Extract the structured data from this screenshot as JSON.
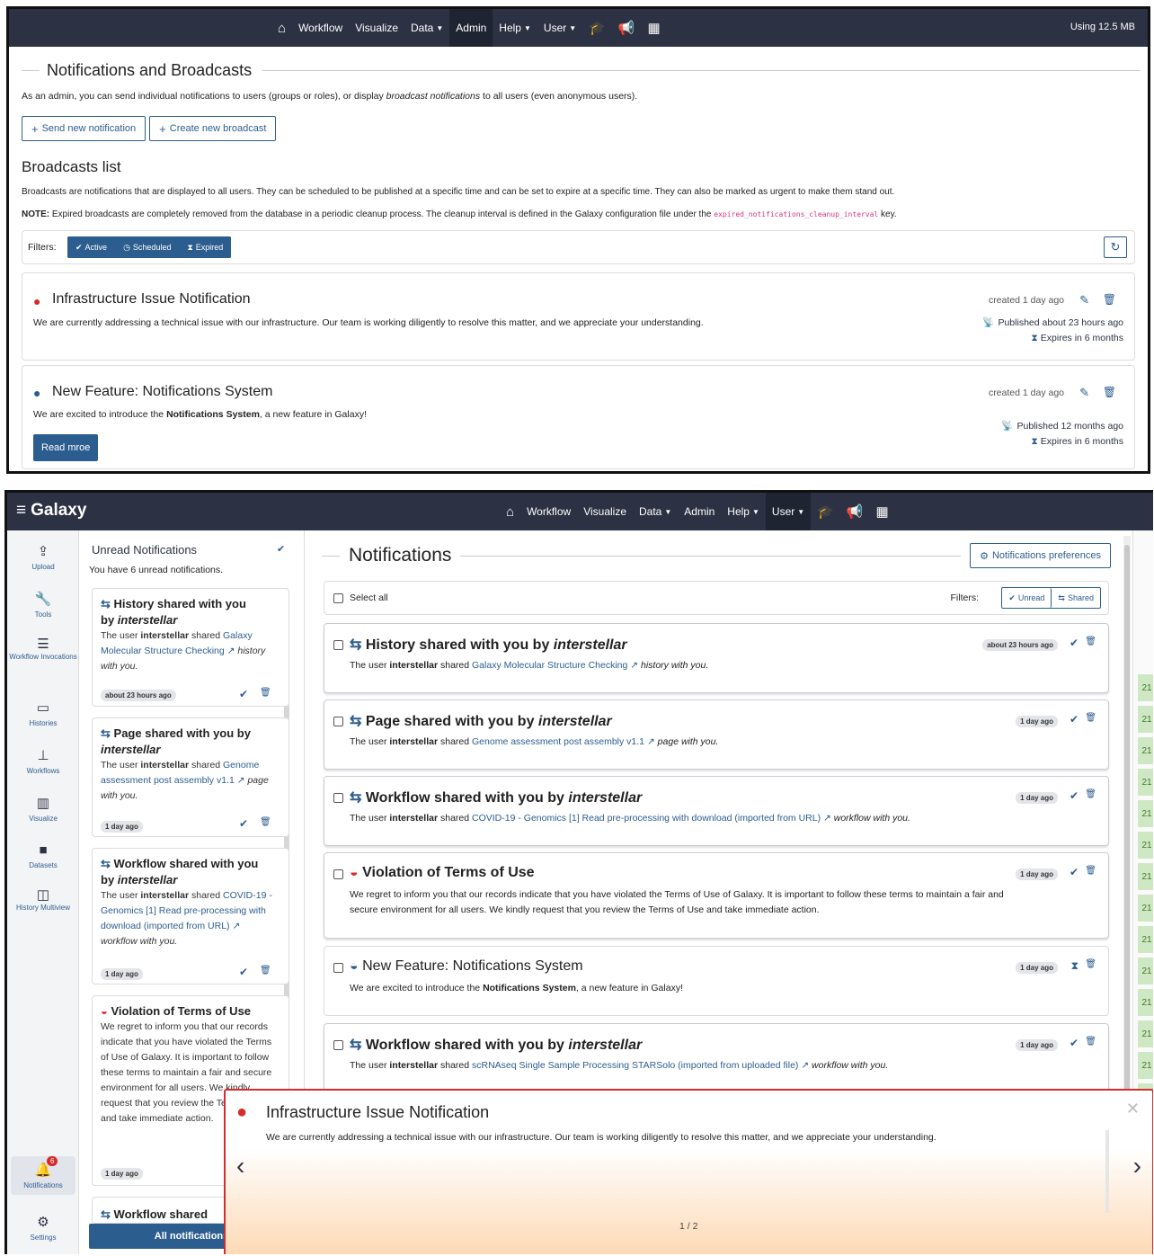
{
  "top": {
    "nav": {
      "items": [
        "Workflow",
        "Visualize",
        "Data",
        "Admin",
        "Help",
        "User"
      ],
      "memory": "Using 12.5 MB"
    },
    "title": "Notifications and Broadcasts",
    "intro_a": "As an admin, you can send individual notifications to users (groups or roles), or display ",
    "intro_em": "broadcast notifications",
    "intro_b": " to all users (even anonymous users).",
    "btn_send": "Send new notification",
    "btn_broadcast": "Create new broadcast",
    "list_title": "Broadcasts list",
    "list_desc": "Broadcasts are notifications that are displayed to all users. They can be scheduled to be published at a specific time and can be set to expire at a specific time. They can also be marked as urgent to make them stand out.",
    "note_label": "NOTE:",
    "note_text": " Expired broadcasts are completely removed from the database in a periodic cleanup process. The cleanup interval is defined in the Galaxy configuration file under the ",
    "note_code": "expired_notifications_cleanup_interval",
    "note_end": " key.",
    "filters_label": "Filters:",
    "filters": [
      "Active",
      "Scheduled",
      "Expired"
    ],
    "broadcasts": [
      {
        "title": "Infrastructure Issue Notification",
        "body": "We are currently addressing a technical issue with our infrastructure. Our team is working diligently to resolve this matter, and we appreciate your understanding.",
        "created": "created 1 day ago",
        "published": "Published about 23 hours ago",
        "expires": "Expires in 6 months"
      },
      {
        "title": "New Feature: Notifications System",
        "body_a": "We are excited to introduce the ",
        "body_b": "Notifications System",
        "body_c": ", a new feature in Galaxy!",
        "created": "created 1 day ago",
        "published": "Published 12 months ago",
        "expires": "Expires in 6 months",
        "read_more": "Read mroe"
      }
    ]
  },
  "bottom": {
    "brand": "Galaxy",
    "nav": {
      "items": [
        "Workflow",
        "Visualize",
        "Data",
        "Admin",
        "Help",
        "User"
      ],
      "notif_count": "6"
    },
    "sidebar": [
      "Upload",
      "Tools",
      "Workflow Invocations",
      "Histories",
      "Workflows",
      "Visualize",
      "Datasets",
      "History Multiview"
    ],
    "sidebar_bottom": [
      "Notifications",
      "Settings"
    ],
    "unread": {
      "title": "Unread Notifications",
      "subtitle": "You have 6 unread notifications.",
      "all_btn": "All notifications",
      "items": [
        {
          "t1": "History shared with you",
          "t2": "by ",
          "who": "interstellar",
          "body_a": "The user ",
          "user": "interstellar",
          "body_b": " shared ",
          "link": "Galaxy Molecular Structure Checking",
          "body_c": " history with you.",
          "time": "about 23 hours ago"
        },
        {
          "t1": "Page shared with you by",
          "who": "interstellar",
          "body_a": "The user ",
          "user": "interstellar",
          "body_b": " shared ",
          "link": "Genome assessment post assembly v1.1",
          "body_c": " page with you.",
          "time": "1 day ago"
        },
        {
          "t1": "Workflow shared with you",
          "t2": "by ",
          "who": "interstellar",
          "body_a": "The user ",
          "user": "interstellar",
          "body_b": " shared ",
          "link": "COVID-19 - Genomics [1] Read pre-processing with download (imported from URL)",
          "body_c": " workflow with you.",
          "time": "1 day ago"
        },
        {
          "t1": "Violation of Terms of Use",
          "body": "We regret to inform you that our records indicate that you have violated the Terms of Use of Galaxy. It is important to follow these terms to maintain a fair and secure environment for all users. We kindly request that you review the Terms of Use and take immediate action.",
          "time": "1 day ago"
        },
        {
          "t1": "Workflow shared"
        }
      ]
    },
    "main": {
      "title": "Notifications",
      "prefs": "Notifications preferences",
      "select_all": "Select all",
      "filters_label": "Filters:",
      "filters": [
        "Unread",
        "Shared"
      ],
      "items": [
        {
          "pre": "History shared with you by ",
          "who": "interstellar",
          "body_a": "The user ",
          "user": "interstellar",
          "body_b": " shared ",
          "link": "Galaxy Molecular Structure Checking",
          "body_c": " history with you.",
          "time": "about 23 hours ago"
        },
        {
          "pre": "Page shared with you by ",
          "who": "interstellar",
          "body_a": "The user ",
          "user": "interstellar",
          "body_b": " shared ",
          "link": "Genome assessment post assembly v1.1",
          "body_c": " page with you.",
          "time": "1 day ago"
        },
        {
          "pre": "Workflow shared with you by ",
          "who": "interstellar",
          "body_a": "The user ",
          "user": "interstellar",
          "body_b": " shared ",
          "link": "COVID-19 - Genomics [1] Read pre-processing with download (imported from URL)",
          "body_c": " workflow with you.",
          "time": "1 day ago"
        },
        {
          "pre": "Violation of Terms of Use",
          "line1": "We regret to inform you that our records indicate that you have violated the Terms of Use of Galaxy. It is important to follow these terms to maintain a fair and",
          "line2": "secure environment for all users. We kindly request that you review the Terms of Use and take immediate action.",
          "time": "1 day ago"
        },
        {
          "pre": "New Feature: Notifications System",
          "body_a": "We are excited to introduce the ",
          "body_b": "Notifications System",
          "body_c": ", a new feature in Galaxy!",
          "time": "1 day ago"
        },
        {
          "pre": "Workflow shared with you by ",
          "who": "interstellar",
          "body_a": "The user ",
          "user": "interstellar",
          "body_b": " shared ",
          "link": "scRNAseq Single Sample Processing STARSolo (imported from uploaded file)",
          "body_c": " workflow with you.",
          "time": "1 day ago"
        }
      ]
    },
    "toast": {
      "title": "Infrastructure Issue Notification",
      "body": "We are currently addressing a technical issue with our infrastructure. Our team is working diligently to resolve this matter, and we appreciate your understanding.",
      "pager": "1 / 2"
    },
    "right_col": [
      "21",
      "21",
      "21",
      "21",
      "21",
      "21",
      "21",
      "21",
      "21",
      "21",
      "21",
      "21",
      "21",
      "21"
    ]
  },
  "colors": {
    "navbar": "#2c3143",
    "accent": "#2c5d8f",
    "danger": "#d62b2b",
    "toast_bottom": "#fdd9b5"
  }
}
